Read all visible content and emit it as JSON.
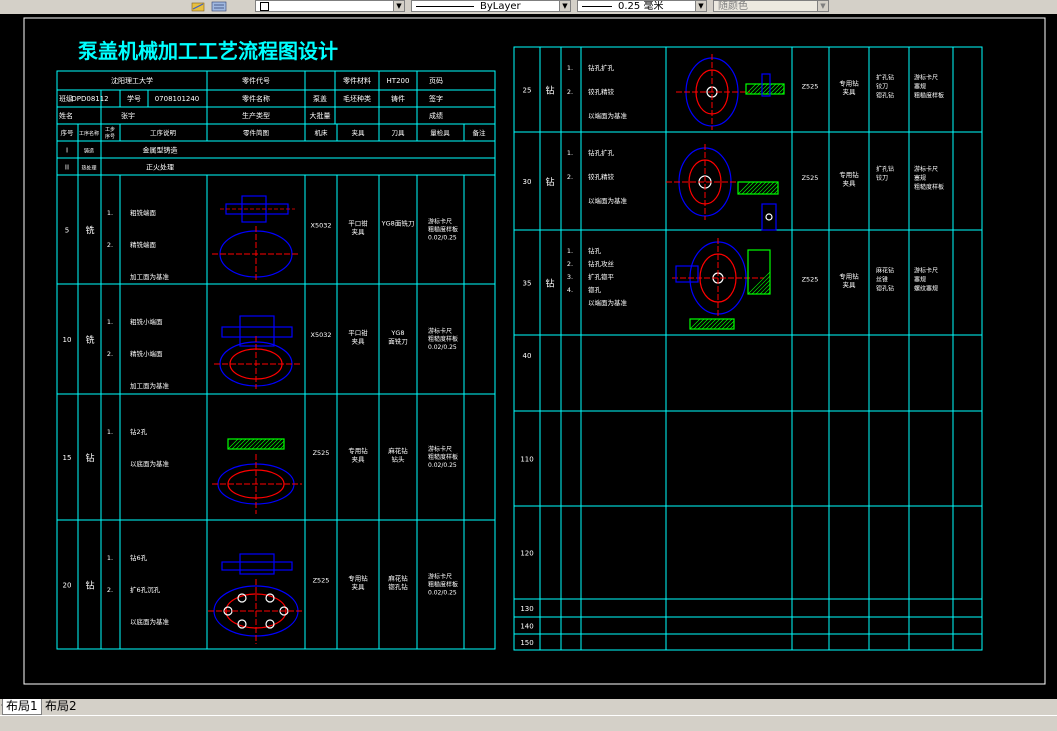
{
  "toolbar": {
    "color_combo": "",
    "linetype_combo": "ByLayer",
    "lineweight_combo": "0.25 毫米",
    "plotstyle_combo": "随颜色"
  },
  "drawing": {
    "title": "泵盖机械加工工艺流程图设计",
    "colors": {
      "frame": "#00ffff",
      "title": "#00ffff",
      "text": "#ffffff",
      "sketch_blue": "#0000ff",
      "sketch_red": "#ff0000",
      "hatch": "#00ff00"
    },
    "header": {
      "school": "沈阳理工大学",
      "part_number_label": "零件代号",
      "material_label": "零件材料",
      "material": "HT200",
      "sheet_label": "页码",
      "class_label": "班级",
      "class": "DPD08112",
      "student_no_label": "学号",
      "student_no": "0708101240",
      "part_name_label": "零件名称",
      "part_name": "泵盖",
      "blank_type": "毛坯种类",
      "casting": "铸件",
      "sign": "签字",
      "name_label": "姓名",
      "name": "张宇",
      "production_type": "生产类型",
      "batch": "大批量",
      "grade": "成绩"
    },
    "columns": [
      "序号",
      "工序名称",
      "工步序号",
      "工序说明",
      "零件简图",
      "机床",
      "夹具",
      "刀具",
      "量检具",
      "备注"
    ],
    "left_rows": [
      {
        "no": "I",
        "name": "铸造",
        "desc": "金属型铸造"
      },
      {
        "no": "II",
        "name": "热处理",
        "desc": "正火处理"
      },
      {
        "no": "5",
        "name": "铣",
        "steps": [
          {
            "n": "1.",
            "t": "粗铣端面"
          },
          {
            "n": "2.",
            "t": "精铣端面"
          },
          {
            "n": "",
            "t": "加工面为基准"
          }
        ],
        "machine": "X5032",
        "fixture": "平口钳 夹具",
        "tool": "YG8面铣刀",
        "gauge": "游标卡尺 粗糙度样板 0.02/0.25"
      },
      {
        "no": "10",
        "name": "铣",
        "steps": [
          {
            "n": "1.",
            "t": "粗铣小端面"
          },
          {
            "n": "2.",
            "t": "精铣小端面"
          },
          {
            "n": "",
            "t": "加工面为基准"
          }
        ],
        "machine": "X5032",
        "fixture": "平口钳 夹具",
        "tool": "YG8 面铣刀",
        "gauge": "游标卡尺 粗糙度样板 0.02/0.25"
      },
      {
        "no": "15",
        "name": "钻",
        "steps": [
          {
            "n": "1.",
            "t": "钻2孔"
          },
          {
            "n": "",
            "t": "以底面为基准"
          }
        ],
        "machine": "Z525",
        "fixture": "专用钻 夹具",
        "tool": "麻花钻 钻头",
        "gauge": "游标卡尺 粗糙度样板 0.02/0.25"
      },
      {
        "no": "20",
        "name": "钻",
        "steps": [
          {
            "n": "1.",
            "t": "钻6孔"
          },
          {
            "n": "2.",
            "t": "扩6孔沉孔"
          },
          {
            "n": "",
            "t": "以底面为基准"
          }
        ],
        "machine": "Z525",
        "fixture": "专用钻 夹具",
        "tool": "麻花钻 锪孔钻",
        "gauge": "游标卡尺 粗糙度样板 0.02/0.25"
      }
    ],
    "right_rows": [
      {
        "no": "25",
        "name": "钻",
        "steps": [
          {
            "n": "1.",
            "t": "钻孔扩孔"
          },
          {
            "n": "2.",
            "t": "铰孔精铰"
          },
          {
            "n": "",
            "t": "以端面为基准"
          }
        ],
        "machine": "Z525",
        "fixture": "专用钻 夹具",
        "tool": "扩孔钻 铰刀 锪孔钻",
        "gauge": "游标卡尺 塞规 粗糙度样板"
      },
      {
        "no": "30",
        "name": "钻",
        "steps": [
          {
            "n": "1.",
            "t": "钻孔扩孔"
          },
          {
            "n": "2.",
            "t": "铰孔精铰"
          },
          {
            "n": "",
            "t": "以端面为基准"
          }
        ],
        "machine": "Z525",
        "fixture": "专用钻 夹具",
        "tool": "扩孔钻 铰刀",
        "gauge": "游标卡尺 塞规 粗糙度样板"
      },
      {
        "no": "35",
        "name": "钻",
        "steps": [
          {
            "n": "1.",
            "t": "钻孔"
          },
          {
            "n": "2.",
            "t": "钻孔攻丝"
          },
          {
            "n": "3.",
            "t": "扩孔锪平"
          },
          {
            "n": "4.",
            "t": "锪孔"
          },
          {
            "n": "",
            "t": "以端面为基准"
          }
        ],
        "machine": "Z525",
        "fixture": "专用钻 夹具",
        "tool": "麻花钻 丝锥 锪孔钻",
        "gauge": "游标卡尺 塞规 螺纹塞规"
      },
      {
        "no": "40"
      },
      {
        "no": "110"
      },
      {
        "no": "120"
      },
      {
        "no": "130"
      },
      {
        "no": "140"
      },
      {
        "no": "150"
      }
    ]
  },
  "layout_tabs": [
    "布局1",
    "布局2"
  ]
}
